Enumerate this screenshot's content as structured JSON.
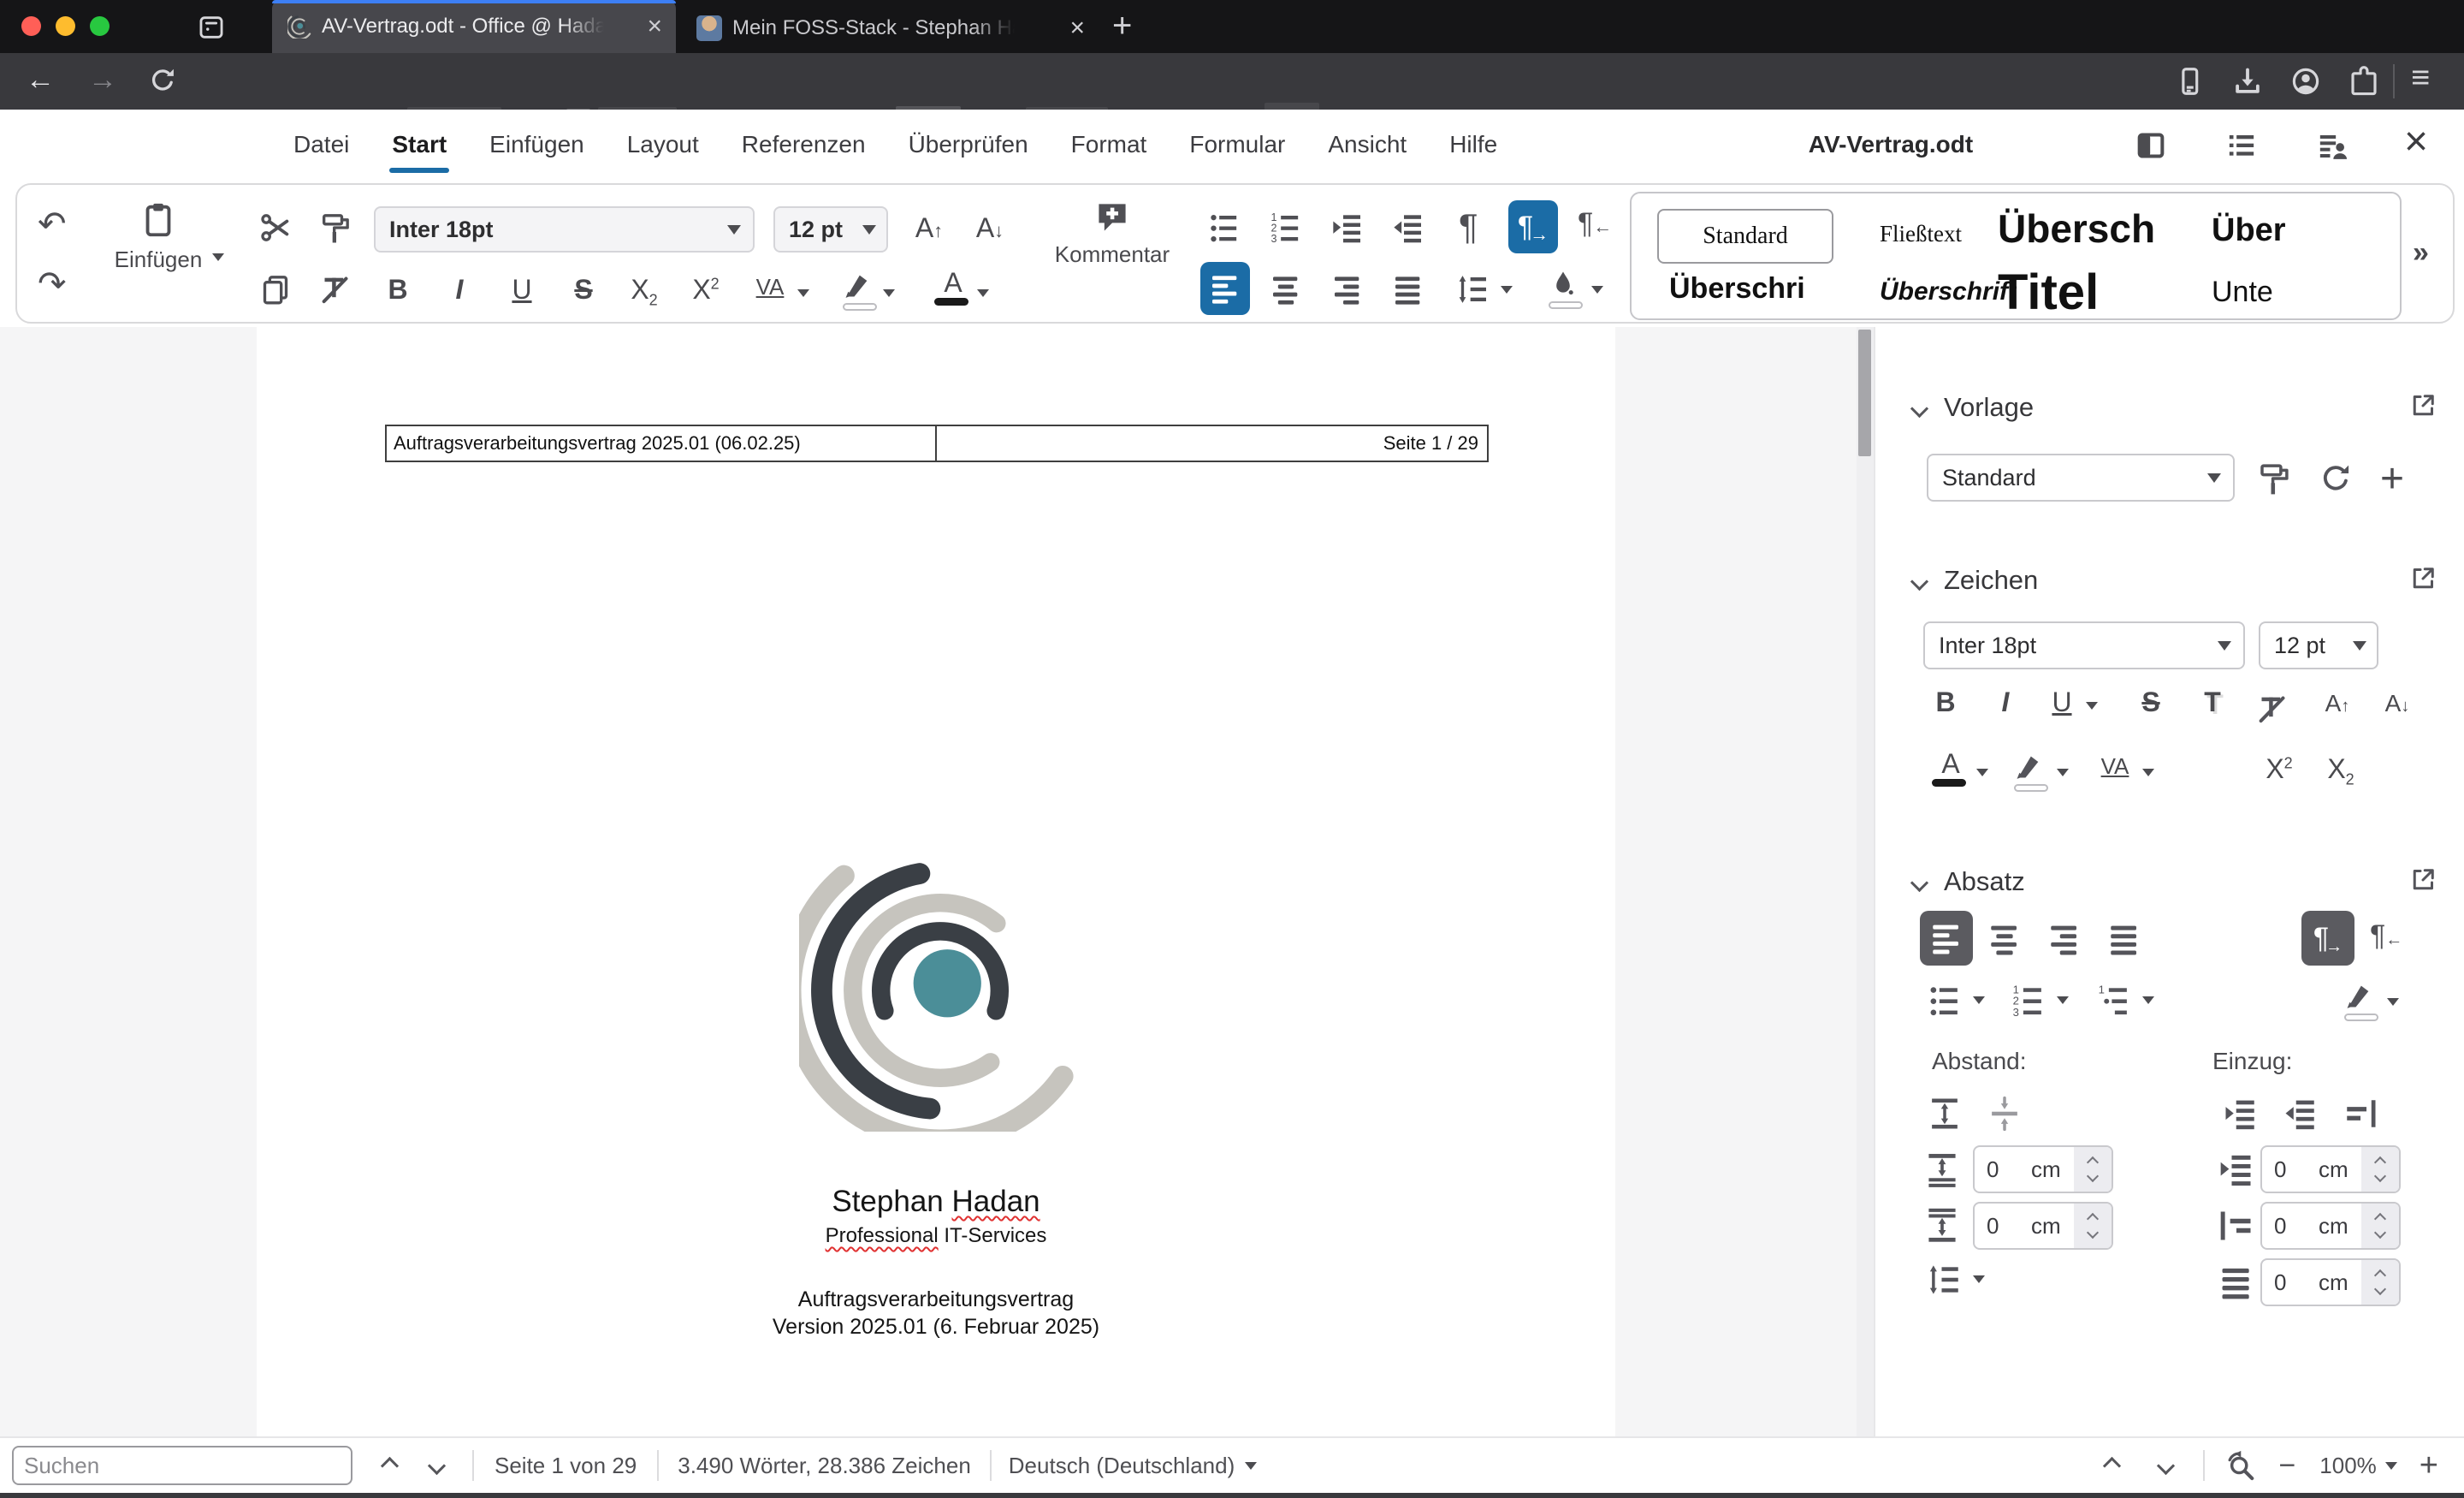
{
  "browser": {
    "tabs": [
      {
        "title": "AV-Vertrag.odt - Office @ Hada"
      },
      {
        "title": "Mein FOSS-Stack - Stephan Ha"
      }
    ],
    "search_placeholder": "Suchen"
  },
  "menu": {
    "items": [
      "Datei",
      "Start",
      "Einfügen",
      "Layout",
      "Referenzen",
      "Überprüfen",
      "Format",
      "Formular",
      "Ansicht",
      "Hilfe"
    ],
    "doc_title": "AV-Vertrag.odt"
  },
  "toolbar": {
    "paste_label": "Einfügen",
    "comment_label": "Kommentar",
    "font_name": "Inter 18pt",
    "font_size": "12 pt"
  },
  "styles_gallery": {
    "items": [
      "Standard",
      "Fließtext",
      "Übersch",
      "Über",
      "Überschri",
      "Überschrift",
      "Titel",
      "Unte"
    ],
    "more": "»"
  },
  "glyphs": {
    "bold": "B",
    "italic": "I",
    "underline": "U",
    "strike": "S",
    "letter_a": "A",
    "letter_x": "X",
    "two": "2",
    "va": "VA",
    "letter_t": "T",
    "pilcrow": "¶",
    "check": "✓",
    "plus": "+",
    "minus": "−",
    "close": "×",
    "star": "☆",
    "undo": "↶",
    "redo": "↷",
    "back": "←",
    "forward": "→"
  },
  "sidebar": {
    "vorlage": {
      "title": "Vorlage",
      "value": "Standard"
    },
    "zeichen": {
      "title": "Zeichen",
      "font_name": "Inter 18pt",
      "font_size": "12 pt"
    },
    "absatz": {
      "title": "Absatz",
      "spacing_label": "Abstand:",
      "indent_label": "Einzug:",
      "spacing_fields": [
        {
          "value": "0",
          "unit": "cm"
        },
        {
          "value": "0",
          "unit": "cm"
        }
      ],
      "indent_fields": [
        {
          "value": "0",
          "unit": "cm"
        },
        {
          "value": "0",
          "unit": "cm"
        },
        {
          "value": "0",
          "unit": "cm"
        }
      ]
    }
  },
  "document": {
    "header_left": "Auftragsverarbeitungsvertrag 2025.01 (06.02.25)",
    "header_right": "Seite 1 / 29",
    "name_prefix": "Stephan ",
    "name_misspelled": "Hadan",
    "tagline_misspelled": "Professional",
    "tagline_rest": " IT-Services",
    "title_line1": "Auftragsverarbeitungsvertrag",
    "title_line2": "Version 2025.01 (6. Februar 2025)"
  },
  "statusbar": {
    "search_placeholder": "Suchen",
    "page": "Seite 1 von 29",
    "words": "3.490 Wörter, 28.386 Zeichen",
    "language": "Deutsch (Deutschland)",
    "zoom": "100%"
  },
  "colors": {
    "accent_blue": "#1b6ca6",
    "firefox_accent": "#3d7ff5",
    "logo_teal": "#4b8e98",
    "logo_dark": "#3a3f45",
    "logo_gray": "#c6c4be"
  }
}
